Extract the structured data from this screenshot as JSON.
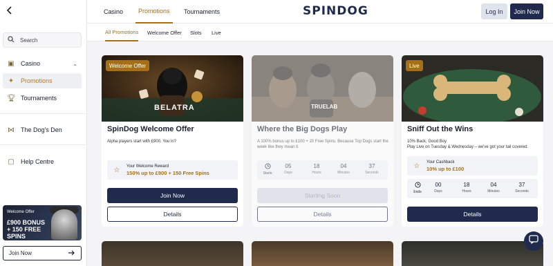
{
  "sidebar": {
    "back_icon": "chevron-left-icon",
    "search_placeholder": "Search",
    "items": [
      {
        "label": "Casino",
        "icon": "casino-chip-icon"
      },
      {
        "label": "Promotions",
        "icon": "sparkle-icon"
      },
      {
        "label": "Tournaments",
        "icon": "trophy-icon"
      },
      {
        "label": "The Dog's Den",
        "icon": "bone-icon"
      },
      {
        "label": "Help Centre",
        "icon": "chat-bubble-icon"
      }
    ],
    "banner": {
      "label": "Welcome Offer",
      "headline": "£900 BONUS + 150 FREE SPINS"
    },
    "join_label": "Join Now"
  },
  "topnav": {
    "tabs": [
      "Casino",
      "Promotions",
      "Tournaments"
    ],
    "active_tab": "Promotions",
    "logo": "SPINDOG",
    "login_label": "Log In",
    "join_label": "Join Now"
  },
  "subnav": {
    "tabs": [
      "All Promotions",
      "Welcome Offer",
      "Slots",
      "Live"
    ],
    "active_tab": "All Promotions"
  },
  "cards": [
    {
      "badge": "Welcome Offer",
      "image_text": "BELATRA",
      "title": "SpinDog Welcome Offer",
      "desc": "Alpha players start with £900. You in?",
      "reward_label": "Your Welcome Reward",
      "reward_value": "150% up to £900 + 150 Free Spins",
      "primary": "Join Now",
      "secondary": "Details"
    },
    {
      "image_text": "TRUELAB",
      "title": "Where the Big Dogs Play",
      "desc": "A 100% bonus up to £100 + 20 Free Spins. Because Top Dogs start the week like they mean it.",
      "countdown_label": "Starts",
      "countdown": [
        {
          "n": "05",
          "u": "Days"
        },
        {
          "n": "18",
          "u": "Hours"
        },
        {
          "n": "04",
          "u": "Minutes"
        },
        {
          "n": "37",
          "u": "Seconds"
        }
      ],
      "primary": "Starting Soon",
      "secondary": "Details"
    },
    {
      "badge": "Live",
      "title": "Sniff Out the Wins",
      "desc_line1": "10% Back, Good Boy",
      "desc_line2": "Play Live on Tuesday & Wednesday – we've got your tail covered.",
      "reward_label": "Your Cashback",
      "reward_value": "10% up to £100",
      "countdown_label": "Ends",
      "countdown": [
        {
          "n": "00",
          "u": "Days"
        },
        {
          "n": "18",
          "u": "Hours"
        },
        {
          "n": "04",
          "u": "Minutes"
        },
        {
          "n": "37",
          "u": "Seconds"
        }
      ],
      "primary": "Details"
    }
  ],
  "colors": {
    "accent": "#a56f17",
    "navy": "#1f2a4d",
    "background": "#f4f4f6"
  }
}
